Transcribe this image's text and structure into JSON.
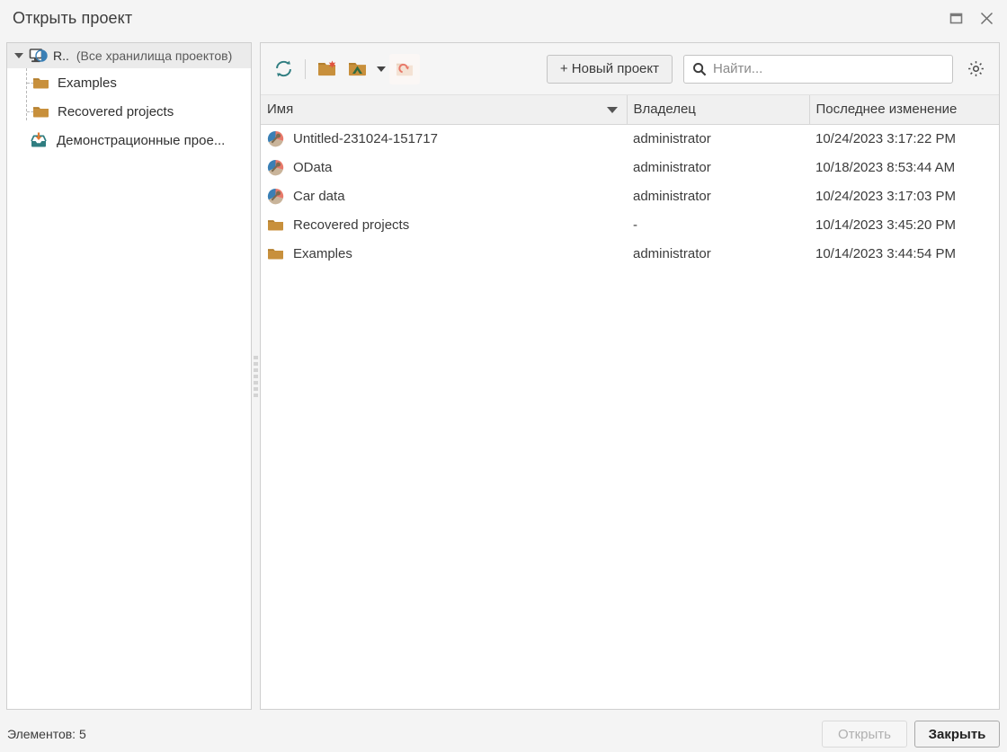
{
  "window": {
    "title": "Открыть проект",
    "maximize_icon": "maximize-icon",
    "close_icon": "close-icon"
  },
  "tree": {
    "root": {
      "label": "R..",
      "sublabel": "(Все хранилища проектов)",
      "icon": "repository-icon",
      "expander": "chevron-down-icon"
    },
    "items": [
      {
        "label": "Examples",
        "icon": "folder-icon"
      },
      {
        "label": "Recovered projects",
        "icon": "folder-icon"
      },
      {
        "label": "Демонстрационные прое...",
        "icon": "download-tray-icon"
      }
    ]
  },
  "toolbar": {
    "refresh_icon": "refresh-icon",
    "new_folder_icon": "new-folder-icon",
    "open_folder_icon": "open-folder-icon",
    "dropdown_icon": "chevron-down-icon",
    "clone_folder_icon": "clone-folder-icon",
    "new_project_label": "+ Новый проект",
    "settings_icon": "gear-icon"
  },
  "search": {
    "placeholder": "Найти...",
    "value": "",
    "icon": "search-icon"
  },
  "table": {
    "columns": [
      "Имя",
      "Владелец",
      "Последнее изменение"
    ],
    "sort_column": "Имя",
    "sort_direction": "desc",
    "rows": [
      {
        "icon": "project-icon",
        "name": "Untitled-231024-151717",
        "owner": "administrator",
        "modified": "10/24/2023 3:17:22 PM"
      },
      {
        "icon": "project-icon",
        "name": "OData",
        "owner": "administrator",
        "modified": "10/18/2023 8:53:44 AM"
      },
      {
        "icon": "project-icon",
        "name": "Car data",
        "owner": "administrator",
        "modified": "10/24/2023 3:17:03 PM"
      },
      {
        "icon": "folder-icon",
        "name": "Recovered projects",
        "owner": "-",
        "modified": "10/14/2023 3:45:20 PM"
      },
      {
        "icon": "folder-icon",
        "name": "Examples",
        "owner": "administrator",
        "modified": "10/14/2023 3:44:54 PM"
      }
    ]
  },
  "status": {
    "count_label": "Элементов: 5",
    "open_label": "Открыть",
    "close_label": "Закрыть"
  },
  "colors": {
    "folder": "#c8903c",
    "accent_teal": "#2f7d80",
    "project_blue": "#3a7fb5",
    "project_salmon": "#e8796a"
  }
}
